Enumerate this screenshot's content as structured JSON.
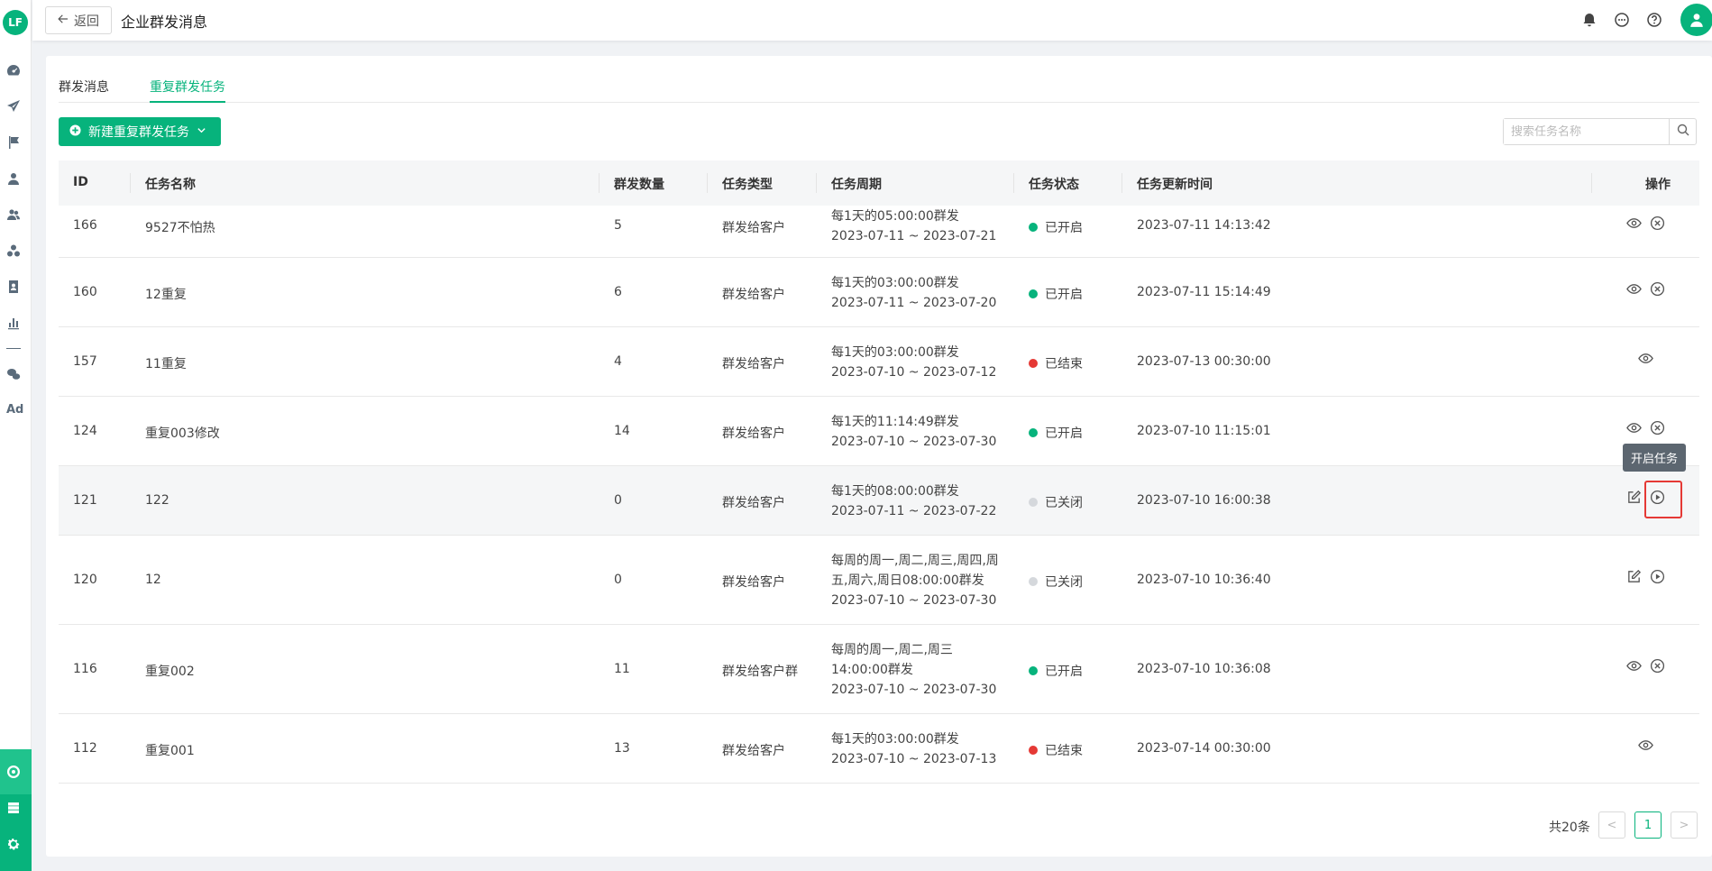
{
  "app": {
    "logo_text": "LF"
  },
  "header": {
    "back_label": "返回",
    "title": "企业群发消息",
    "icons": [
      "bell-icon",
      "message-icon",
      "help-icon",
      "user-avatar-icon"
    ]
  },
  "tabs": [
    {
      "label": "群发消息",
      "active": false
    },
    {
      "label": "重复群发任务",
      "active": true
    }
  ],
  "toolbar": {
    "new_button_label": "新建重复群发任务",
    "search_placeholder": "搜索任务名称"
  },
  "table": {
    "headers": {
      "id": "ID",
      "name": "任务名称",
      "count": "群发数量",
      "type": "任务类型",
      "period": "任务周期",
      "status": "任务状态",
      "updated": "任务更新时间",
      "ops": "操作"
    },
    "rows": [
      {
        "id": "166",
        "name": "9527不怕热",
        "count": "5",
        "type": "群发给客户",
        "period_lines": [
          "每1天的05:00:00群发",
          "2023-07-11 ~ 2023-07-21"
        ],
        "status": "已开启",
        "status_color": "#07b37c",
        "updated": "2023-07-11 14:13:42",
        "ops": [
          "eye-icon",
          "close-circle-icon"
        ]
      },
      {
        "id": "160",
        "name": "12重复",
        "count": "6",
        "type": "群发给客户",
        "period_lines": [
          "每1天的03:00:00群发",
          "2023-07-11 ~ 2023-07-20"
        ],
        "status": "已开启",
        "status_color": "#07b37c",
        "updated": "2023-07-11 15:14:49",
        "ops": [
          "eye-icon",
          "close-circle-icon"
        ]
      },
      {
        "id": "157",
        "name": "11重复",
        "count": "4",
        "type": "群发给客户",
        "period_lines": [
          "每1天的03:00:00群发",
          "2023-07-10 ~ 2023-07-12"
        ],
        "status": "已结束",
        "status_color": "#e53935",
        "updated": "2023-07-13 00:30:00",
        "ops": [
          "eye-icon"
        ]
      },
      {
        "id": "124",
        "name": "重复003修改",
        "count": "14",
        "type": "群发给客户",
        "period_lines": [
          "每1天的11:14:49群发",
          "2023-07-10 ~ 2023-07-30"
        ],
        "status": "已开启",
        "status_color": "#07b37c",
        "updated": "2023-07-10 11:15:01",
        "ops": [
          "eye-icon",
          "close-circle-icon"
        ]
      },
      {
        "id": "121",
        "name": "122",
        "count": "0",
        "type": "群发给客户",
        "period_lines": [
          "每1天的08:00:00群发",
          "2023-07-11 ~ 2023-07-22"
        ],
        "status": "已关闭",
        "status_color": "#d5d8dc",
        "updated": "2023-07-10 16:00:38",
        "ops": [
          "edit-icon",
          "play-circle-icon"
        ]
      },
      {
        "id": "120",
        "name": "12",
        "count": "0",
        "type": "群发给客户",
        "period_lines": [
          "每周的周一,周二,周三,周四,周",
          "五,周六,周日08:00:00群发",
          "2023-07-10 ~ 2023-07-30"
        ],
        "status": "已关闭",
        "status_color": "#d5d8dc",
        "updated": "2023-07-10 10:36:40",
        "ops": [
          "edit-icon",
          "play-circle-icon"
        ]
      },
      {
        "id": "116",
        "name": "重复002",
        "count": "11",
        "type": "群发给客户群",
        "period_lines": [
          "每周的周一,周二,周三",
          "14:00:00群发",
          "2023-07-10 ~ 2023-07-30"
        ],
        "status": "已开启",
        "status_color": "#07b37c",
        "updated": "2023-07-10 10:36:08",
        "ops": [
          "eye-icon",
          "close-circle-icon"
        ]
      },
      {
        "id": "112",
        "name": "重复001",
        "count": "13",
        "type": "群发给客户",
        "period_lines": [
          "每1天的03:00:00群发",
          "2023-07-10 ~ 2023-07-13"
        ],
        "status": "已结束",
        "status_color": "#e53935",
        "updated": "2023-07-14 00:30:00",
        "ops": [
          "eye-icon"
        ]
      }
    ]
  },
  "tooltip": {
    "text": "开启任务"
  },
  "pagination": {
    "total_label": "共20条",
    "current_page": "1",
    "prev": "<",
    "next": ">"
  },
  "colors": {
    "accent": "#07b37c",
    "danger": "#e53935",
    "inactive": "#d5d8dc"
  }
}
